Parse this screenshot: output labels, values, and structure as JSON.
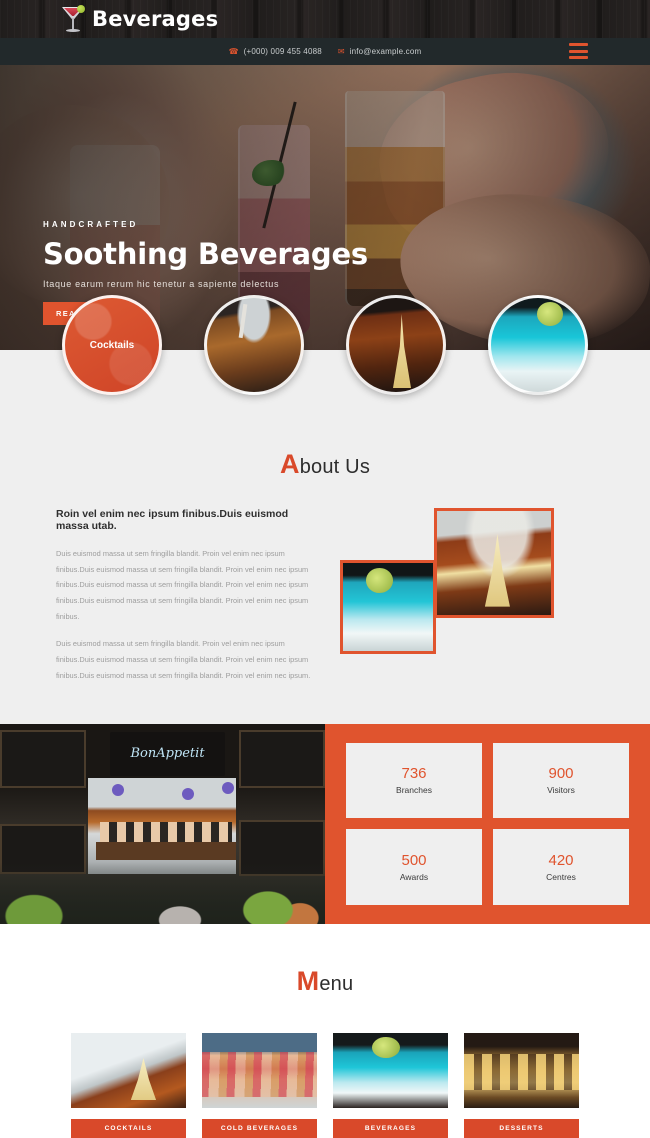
{
  "header": {
    "brand_name": "Beverages",
    "logo_icon": "martini-glass-icon",
    "phone_icon": "phone-icon",
    "phone": "(+000) 009 455 4088",
    "mail_icon": "envelope-icon",
    "email": "info@example.com",
    "menu_icon": "hamburger-menu-icon"
  },
  "hero": {
    "kicker": "HANDCRAFTED",
    "title": "Soothing Beverages",
    "subtitle": "Itaque earum rerum hic tenetur a sapiente delectus",
    "cta_label": "READ MORE"
  },
  "categories": [
    {
      "label": "Cocktails",
      "name": "category-cocktails"
    },
    {
      "label": "",
      "name": "category-iced-coffee"
    },
    {
      "label": "",
      "name": "category-dark-beverage"
    },
    {
      "label": "",
      "name": "category-blue-margarita"
    }
  ],
  "about": {
    "title_cap": "A",
    "title_rest": "bout Us",
    "heading": "Roin vel enim nec ipsum finibus.Duis euismod massa utab.",
    "paragraph1": "Duis euismod massa ut sem fringilla blandit. Proin vel enim nec ipsum finibus.Duis euismod massa ut sem fringilla blandit. Proin vel enim nec ipsum finibus.Duis euismod massa ut sem fringilla blandit. Proin vel enim nec ipsum finibus.Duis euismod massa ut sem fringilla blandit. Proin vel enim nec ipsum finibus.",
    "paragraph2": "Duis euismod massa ut sem fringilla blandit. Proin vel enim nec ipsum finibus.Duis euismod massa ut sem fringilla blandit. Proin vel enim nec ipsum finibus.Duis euismod massa ut sem fringilla blandit. Proin vel enim nec ipsum."
  },
  "gallery": {
    "restaurant_sign": "BonAppetit"
  },
  "stats": [
    {
      "number": "736",
      "label": "Branches"
    },
    {
      "number": "900",
      "label": "Visitors"
    },
    {
      "number": "500",
      "label": "Awards"
    },
    {
      "number": "420",
      "label": "Centres"
    }
  ],
  "menu": {
    "title_cap": "M",
    "title_rest": "enu",
    "items": [
      {
        "label": "COCKTAILS"
      },
      {
        "label": "COLD BEVERAGES"
      },
      {
        "label": "BEVERAGES"
      },
      {
        "label": "DESSERTS"
      }
    ]
  },
  "colors": {
    "accent": "#e0542e",
    "accent_dark": "#d9492a",
    "section_bg": "#efefef",
    "topbar_bg": "#1e1b1a",
    "contactbar_bg": "#22292b",
    "body_text": "#9d9d9d"
  }
}
